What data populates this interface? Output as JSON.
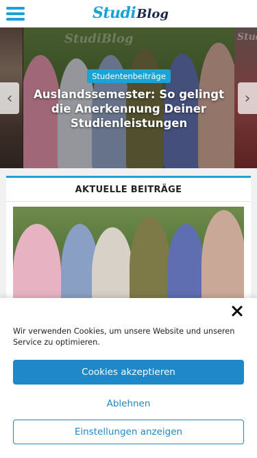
{
  "header": {
    "logo_part1": "Studi",
    "logo_part2": "Blog",
    "menu_icon": "hamburger-menu-icon"
  },
  "slider": {
    "category": "Studentenbeiträge",
    "title": "Auslandssemester: So gelingt die Anerkennung Deiner Studienleistungen",
    "prev_icon": "chevron-left-icon",
    "next_icon": "chevron-right-icon"
  },
  "recent": {
    "heading": "AKTUELLE BEITRÄGE"
  },
  "cookie": {
    "text": "Wir verwenden Cookies, um unsere Website und unseren Service zu optimieren.",
    "accept_label": "Cookies akzeptieren",
    "decline_label": "Ablehnen",
    "settings_label": "Einstellungen anzeigen",
    "close_icon": "close-icon"
  },
  "colors": {
    "accent": "#1aa3d4",
    "button": "#1e88c8"
  }
}
